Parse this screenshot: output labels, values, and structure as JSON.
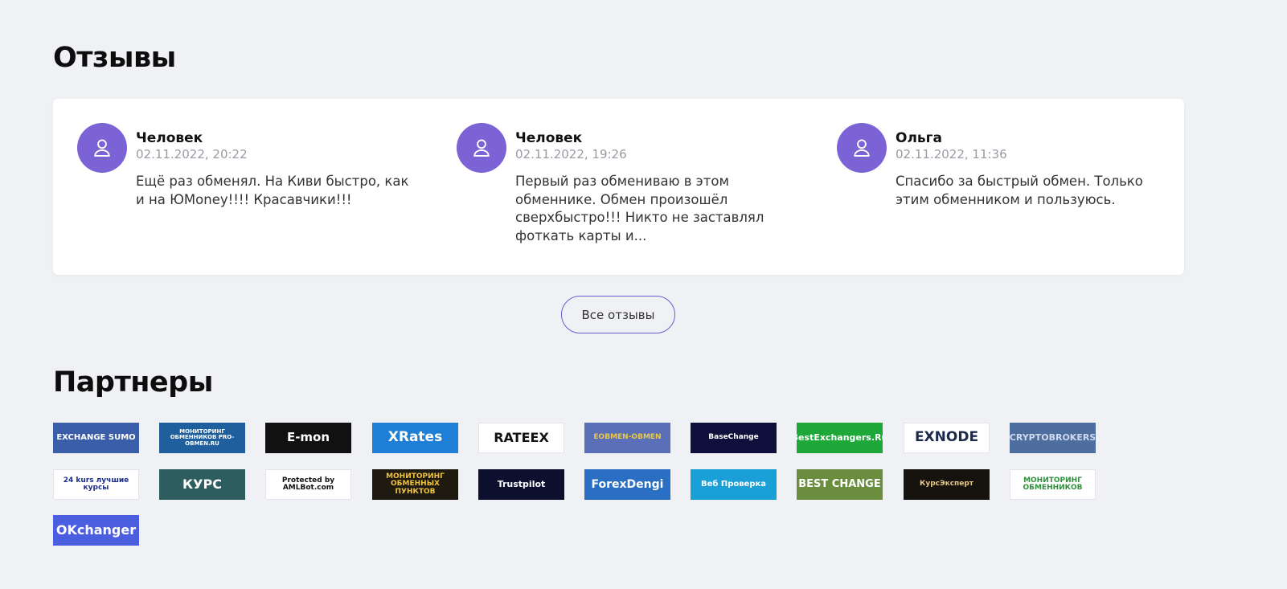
{
  "reviews": {
    "title": "Отзывы",
    "items": [
      {
        "author": "Человек",
        "date": "02.11.2022, 20:22",
        "text": "Ещё раз обменял. На Киви быстро, как и на ЮMoney!!!! Красавчики!!!"
      },
      {
        "author": "Человек",
        "date": "02.11.2022, 19:26",
        "text": "Первый раз обмениваю в этом обменнике. Обмен произошёл сверхбыстро!!! Никто не заставлял фоткать карты и..."
      },
      {
        "author": "Ольга",
        "date": "02.11.2022, 11:36",
        "text": "Спасибо за быстрый обмен. Только этим обменником и пользуюсь."
      }
    ],
    "all_button": "Все отзывы"
  },
  "partners": {
    "title": "Партнеры",
    "items": [
      {
        "label": "EXCHANGE SUMO",
        "bg": "#3a5ea8",
        "color": "#ffffff"
      },
      {
        "label": "МОНИТОРИНГ ОБМЕННИКОВ PRO-OBMEN.RU",
        "bg": "#1f5f9e",
        "color": "#ffffff"
      },
      {
        "label": "E-mon",
        "bg": "#111111",
        "color": "#ffffff"
      },
      {
        "label": "XRates",
        "bg": "#1e7fd6",
        "color": "#ffffff"
      },
      {
        "label": "RATEEX",
        "bg": "#ffffff",
        "color": "#111111"
      },
      {
        "label": "EOBMEN-OBMEN",
        "bg": "#5b6fb8",
        "color": "#e8c84a"
      },
      {
        "label": "BaseChange",
        "bg": "#0e0f3a",
        "color": "#ffffff"
      },
      {
        "label": "BestExchangers.Ru",
        "bg": "#1fa83a",
        "color": "#ffffff"
      },
      {
        "label": "EXNODE",
        "bg": "#ffffff",
        "color": "#1b2a4a"
      },
      {
        "label": "CRYPTOBROKERS",
        "bg": "#4e6ea0",
        "color": "#cfd9ee"
      },
      {
        "label": "24 kurs лучшие курсы",
        "bg": "#ffffff",
        "color": "#1a2c8c"
      },
      {
        "label": "КУРС",
        "bg": "#2e5d5f",
        "color": "#ffffff"
      },
      {
        "label": "Protected by AMLBot.com",
        "bg": "#ffffff",
        "color": "#111111"
      },
      {
        "label": "МОНИТОРИНГ ОБМЕННЫХ ПУНКТОВ",
        "bg": "#1e1a10",
        "color": "#f0c23a"
      },
      {
        "label": "Trustpilot",
        "bg": "#0c0f2e",
        "color": "#ffffff"
      },
      {
        "label": "ForexDengi",
        "bg": "#2a6fc4",
        "color": "#ffffff"
      },
      {
        "label": "Веб Проверка",
        "bg": "#1a9fd6",
        "color": "#ffffff"
      },
      {
        "label": "BEST CHANGE",
        "bg": "#6b8e3e",
        "color": "#ffffff"
      },
      {
        "label": "КурсЭксперт",
        "bg": "#16120e",
        "color": "#e6c98a"
      },
      {
        "label": "МОНИТОРИНГ ОБМЕННИКОВ",
        "bg": "#ffffff",
        "color": "#2f8f3a"
      },
      {
        "label": "OKchanger",
        "bg": "#4b5ee0",
        "color": "#ffffff"
      }
    ]
  }
}
